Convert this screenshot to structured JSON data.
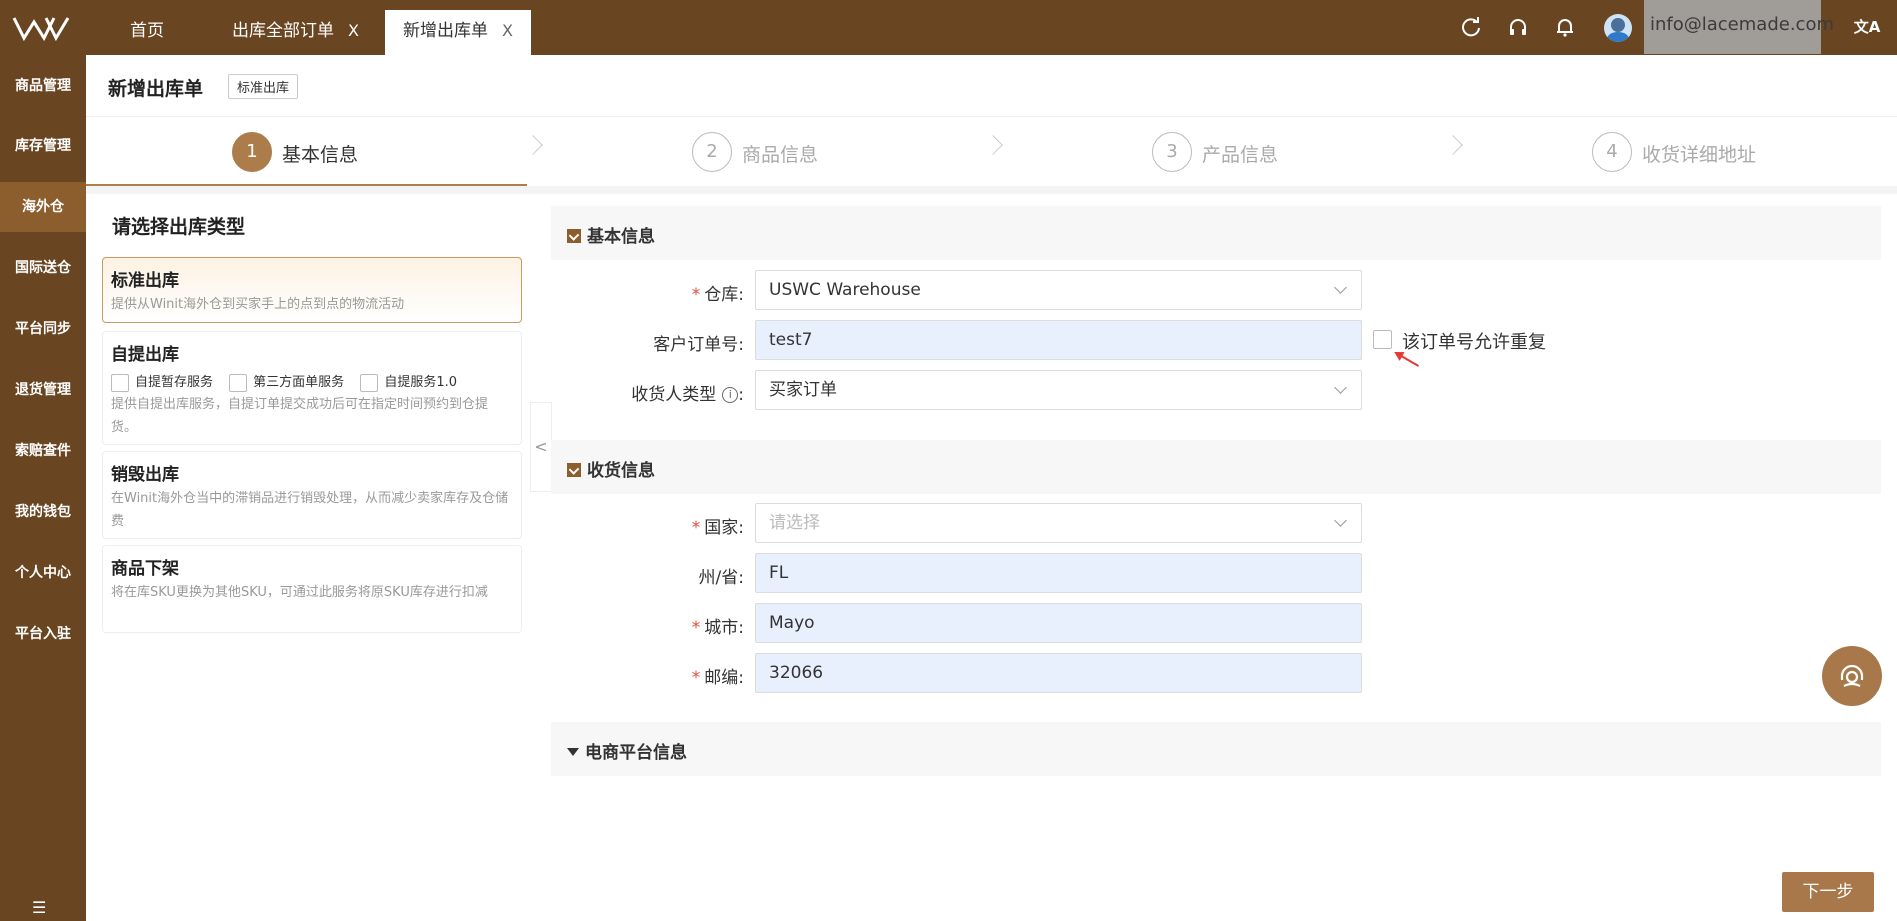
{
  "topbar": {
    "tabs": [
      {
        "label": "首页",
        "closable": false
      },
      {
        "label": "出库全部订单",
        "closable": true
      },
      {
        "label": "新增出库单",
        "closable": true,
        "active": true
      }
    ],
    "close_glyph": "X",
    "icons": [
      "refresh-icon",
      "headset-icon",
      "bell-icon",
      "avatar",
      "translate-icon"
    ],
    "user_email": "info@lacemade.com",
    "translate_glyph": "文A"
  },
  "sidebar": {
    "items": [
      {
        "label": "商品管理"
      },
      {
        "label": "库存管理"
      },
      {
        "label": "海外仓",
        "active": true
      },
      {
        "label": "国际送仓"
      },
      {
        "label": "平台同步"
      },
      {
        "label": "退货管理"
      },
      {
        "label": "索赔查件"
      },
      {
        "label": "我的钱包"
      },
      {
        "label": "个人中心"
      },
      {
        "label": "平台入驻"
      }
    ],
    "collapse_glyph": "☰"
  },
  "header": {
    "title": "新增出库单",
    "tag": "标准出库"
  },
  "steps": [
    {
      "number": "1",
      "label": "基本信息",
      "active": true
    },
    {
      "number": "2",
      "label": "商品信息"
    },
    {
      "number": "3",
      "label": "产品信息"
    },
    {
      "number": "4",
      "label": "收货详细地址"
    }
  ],
  "type_panel": {
    "heading": "请选择出库类型",
    "cards": [
      {
        "title": "标准出库",
        "desc": "提供从Winit海外仓到买家手上的点到点的物流活动",
        "selected": true
      },
      {
        "title": "自提出库",
        "options": [
          "自提暂存服务",
          "第三方面单服务",
          "自提服务1.0"
        ],
        "desc": "提供自提出库服务，自提订单提交成功后可在指定时间预约到仓提货。"
      },
      {
        "title": "销毁出库",
        "desc": "在Winit海外仓当中的滞销品进行销毁处理，从而减少卖家库存及仓储费"
      },
      {
        "title": "商品下架",
        "desc": "将在库SKU更换为其他SKU，可通过此服务将原SKU库存进行扣减"
      }
    ]
  },
  "basic_info": {
    "section_title": "基本信息",
    "warehouse": {
      "label": "仓库",
      "value": "USWC Warehouse"
    },
    "customer_order": {
      "label": "客户订单号",
      "value": "test7"
    },
    "allow_duplicate_label": "该订单号允许重复",
    "consignee_type": {
      "label": "收货人类型",
      "value": "买家订单",
      "info_glyph": "i"
    }
  },
  "shipping_info": {
    "section_title": "收货信息",
    "country": {
      "label": "国家",
      "placeholder": "请选择"
    },
    "state": {
      "label": "州/省",
      "value": "FL"
    },
    "city": {
      "label": "城市",
      "value": "Mayo"
    },
    "zip": {
      "label": "邮编",
      "value": "32066"
    }
  },
  "ecommerce_section": {
    "title": "电商平台信息"
  },
  "actions": {
    "next_label": "下一步"
  },
  "colors": {
    "brand": "#694521",
    "accent": "#a9784a",
    "required": "#e14b3a"
  }
}
